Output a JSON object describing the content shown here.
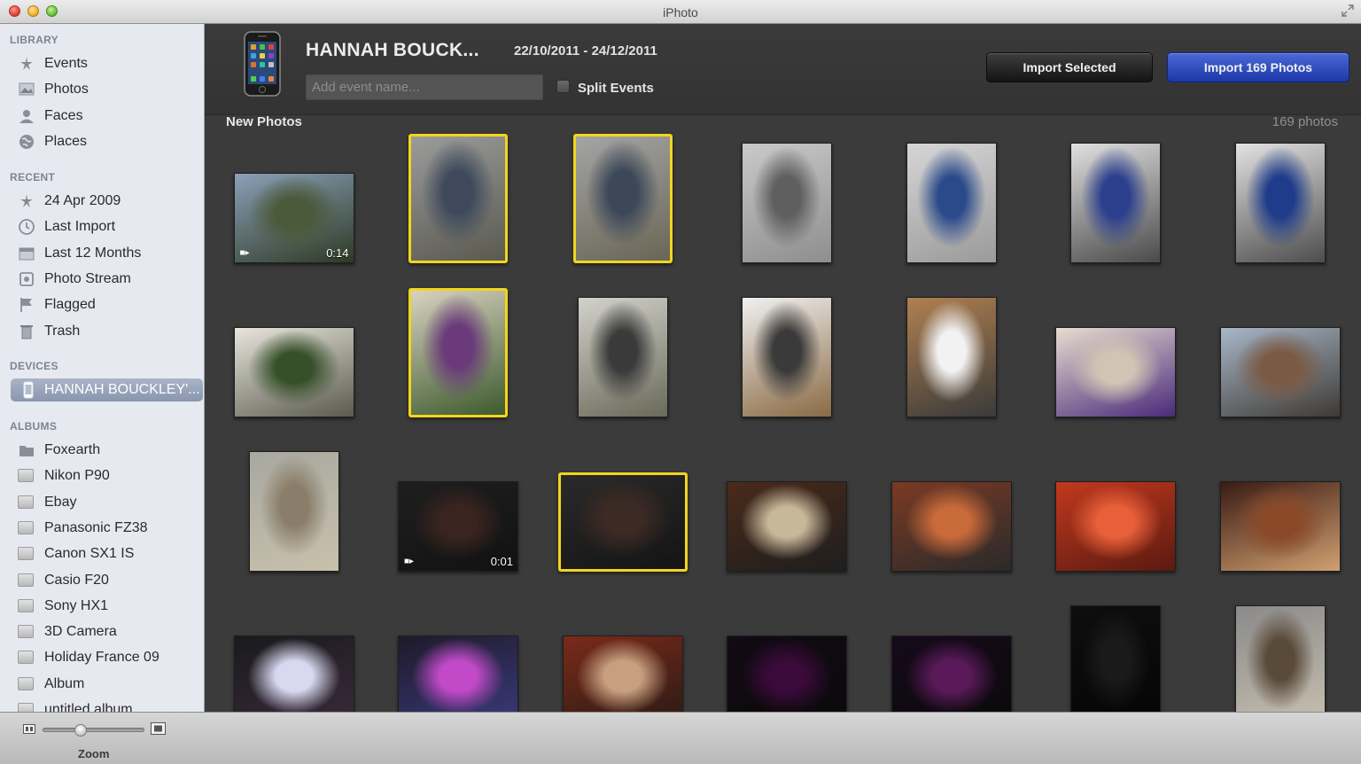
{
  "window": {
    "title": "iPhoto"
  },
  "sidebar": {
    "library": {
      "heading": "LIBRARY",
      "items": [
        {
          "label": "Events",
          "icon": "events-icon"
        },
        {
          "label": "Photos",
          "icon": "photos-icon"
        },
        {
          "label": "Faces",
          "icon": "faces-icon"
        },
        {
          "label": "Places",
          "icon": "places-icon"
        }
      ]
    },
    "recent": {
      "heading": "RECENT",
      "items": [
        {
          "label": "24 Apr 2009",
          "icon": "event-icon"
        },
        {
          "label": "Last Import",
          "icon": "clock-icon"
        },
        {
          "label": "Last 12 Months",
          "icon": "calendar-icon"
        },
        {
          "label": "Photo Stream",
          "icon": "photo-stream-icon"
        },
        {
          "label": "Flagged",
          "icon": "flag-icon"
        },
        {
          "label": "Trash",
          "icon": "trash-icon"
        }
      ]
    },
    "devices": {
      "heading": "DEVICES",
      "items": [
        {
          "label": "HANNAH BOUCKLEY'...",
          "icon": "iphone-icon",
          "selected": true
        }
      ]
    },
    "albums": {
      "heading": "ALBUMS",
      "items": [
        {
          "label": "Foxearth",
          "icon": "folder-icon"
        },
        {
          "label": "Nikon P90",
          "icon": "album-icon"
        },
        {
          "label": "Ebay",
          "icon": "album-icon"
        },
        {
          "label": "Panasonic FZ38",
          "icon": "album-icon"
        },
        {
          "label": "Canon SX1 IS",
          "icon": "album-icon"
        },
        {
          "label": "Casio F20",
          "icon": "album-icon"
        },
        {
          "label": "Sony HX1",
          "icon": "album-icon"
        },
        {
          "label": "3D Camera",
          "icon": "album-icon"
        },
        {
          "label": "Holiday France 09",
          "icon": "album-icon"
        },
        {
          "label": "Album",
          "icon": "album-icon"
        },
        {
          "label": "untitled album",
          "icon": "album-icon"
        }
      ]
    }
  },
  "import_header": {
    "device_name": "HANNAH BOUCK...",
    "date_range": "22/10/2011 - 24/12/2011",
    "event_name_placeholder": "Add event name...",
    "split_events_label": "Split Events",
    "split_events_checked": false,
    "import_selected_label": "Import Selected",
    "import_all_label": "Import 169 Photos"
  },
  "grid": {
    "section_title": "New Photos",
    "photo_count": "169 photos",
    "selection_color": "#f2d51c",
    "photos": [
      {
        "orientation": "landscape",
        "video": true,
        "duration": "0:14",
        "selected": false,
        "colors": [
          "#8ba0b8",
          "#4b5a3a",
          "#2e3a25"
        ]
      },
      {
        "orientation": "portrait",
        "video": false,
        "selected": true,
        "colors": [
          "#9b9b9b",
          "#3e4a5c",
          "#5a5a50"
        ]
      },
      {
        "orientation": "portrait",
        "video": false,
        "selected": true,
        "colors": [
          "#a4a4a4",
          "#3c4858",
          "#6a6656"
        ]
      },
      {
        "orientation": "portrait",
        "video": false,
        "selected": false,
        "colors": [
          "#c9c9c9",
          "#5f5f5f",
          "#8e8e8e"
        ]
      },
      {
        "orientation": "portrait",
        "video": false,
        "selected": false,
        "colors": [
          "#d6d6d6",
          "#2a4a8a",
          "#9a9a9a"
        ]
      },
      {
        "orientation": "portrait",
        "video": false,
        "selected": false,
        "colors": [
          "#e0e0e0",
          "#2b3f8e",
          "#4a4a4a"
        ]
      },
      {
        "orientation": "portrait",
        "video": false,
        "selected": false,
        "colors": [
          "#e2e2e2",
          "#1f3c8a",
          "#4d4d4d"
        ]
      },
      {
        "orientation": "landscape",
        "video": false,
        "selected": false,
        "colors": [
          "#e8e6dc",
          "#36502a",
          "#5a5a4e"
        ]
      },
      {
        "orientation": "portrait",
        "video": false,
        "selected": true,
        "colors": [
          "#d8d2c0",
          "#6a3a7a",
          "#3e5a2e"
        ]
      },
      {
        "orientation": "portrait",
        "video": false,
        "selected": false,
        "colors": [
          "#d2d2cc",
          "#3a3a3a",
          "#6a6a5a"
        ]
      },
      {
        "orientation": "portrait",
        "video": false,
        "selected": false,
        "colors": [
          "#f0f0f0",
          "#3a3a3a",
          "#8a6a44"
        ]
      },
      {
        "orientation": "portrait",
        "video": false,
        "selected": false,
        "colors": [
          "#b08050",
          "#f2f2f2",
          "#3a3a3a"
        ]
      },
      {
        "orientation": "landscape",
        "video": false,
        "selected": false,
        "colors": [
          "#e8ddd0",
          "#d2c4b4",
          "#4a2a7a"
        ]
      },
      {
        "orientation": "landscape",
        "video": false,
        "selected": false,
        "colors": [
          "#a8b6c8",
          "#7a5a44",
          "#3e3a34"
        ]
      },
      {
        "orientation": "portrait",
        "video": false,
        "selected": false,
        "colors": [
          "#a8a8a0",
          "#8a7e6a",
          "#c8c0ac"
        ]
      },
      {
        "orientation": "landscape",
        "video": true,
        "duration": "0:01",
        "selected": false,
        "colors": [
          "#1e1e1e",
          "#3a2420",
          "#121212"
        ]
      },
      {
        "orientation": "landscape",
        "video": false,
        "selected": true,
        "colors": [
          "#2a2a2a",
          "#3c2a24",
          "#141414"
        ]
      },
      {
        "orientation": "landscape",
        "video": false,
        "selected": false,
        "colors": [
          "#4a2a1a",
          "#c8b89a",
          "#1e1e1e"
        ]
      },
      {
        "orientation": "landscape",
        "video": false,
        "selected": false,
        "colors": [
          "#7a3a24",
          "#c86a3a",
          "#2a2a2a"
        ]
      },
      {
        "orientation": "landscape",
        "video": false,
        "selected": false,
        "colors": [
          "#c2391e",
          "#e8603a",
          "#5a1a10"
        ]
      },
      {
        "orientation": "landscape",
        "video": false,
        "selected": false,
        "colors": [
          "#3a1a14",
          "#8a4a2a",
          "#d0a070"
        ]
      },
      {
        "orientation": "landscape",
        "video": false,
        "selected": false,
        "colors": [
          "#1a1a1e",
          "#d8d8f0",
          "#3a2a3a"
        ]
      },
      {
        "orientation": "landscape",
        "video": false,
        "selected": false,
        "colors": [
          "#1e1a2a",
          "#c24ac8",
          "#3a3a7a"
        ]
      },
      {
        "orientation": "landscape",
        "video": false,
        "selected": false,
        "colors": [
          "#7a2a1a",
          "#c8a080",
          "#2a1a14"
        ]
      },
      {
        "orientation": "landscape",
        "video": false,
        "selected": false,
        "colors": [
          "#120a14",
          "#3a0a3a",
          "#0a0a0a"
        ]
      },
      {
        "orientation": "landscape",
        "video": false,
        "selected": false,
        "colors": [
          "#160a1a",
          "#5a1a5a",
          "#0a0a0a"
        ]
      },
      {
        "orientation": "portrait",
        "video": false,
        "selected": false,
        "colors": [
          "#0e0e0e",
          "#1a1a1a",
          "#050505"
        ]
      },
      {
        "orientation": "portrait",
        "video": false,
        "selected": false,
        "colors": [
          "#8a8a8a",
          "#5a4a3a",
          "#c8c0b0"
        ]
      }
    ]
  },
  "toolbar": {
    "zoom_label": "Zoom",
    "zoom_level": 0.35
  }
}
